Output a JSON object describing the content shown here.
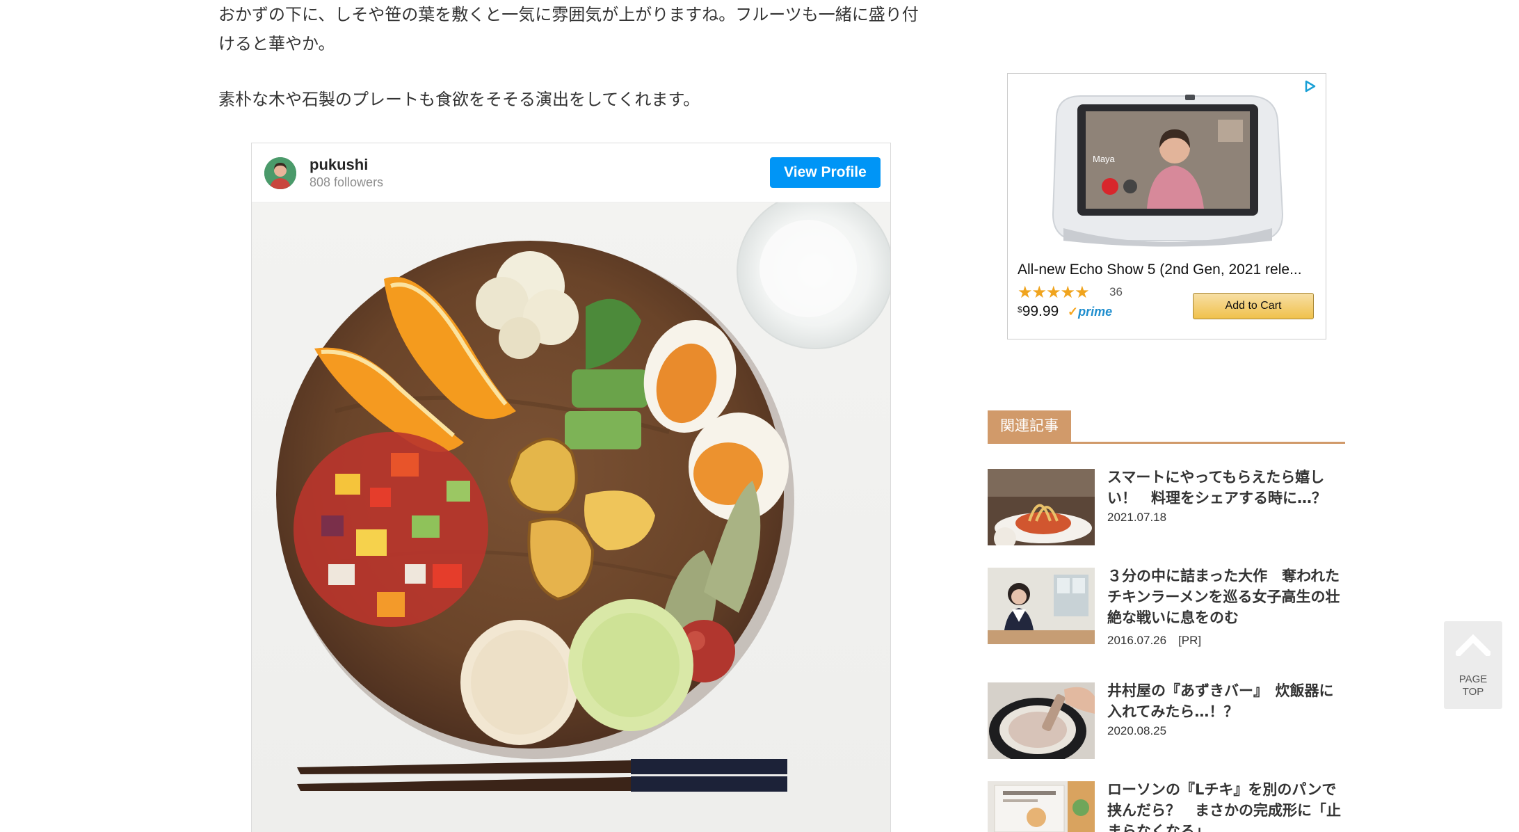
{
  "article": {
    "paragraph1": "おかずの下に、しそや笹の葉を敷くと一気に雰囲気が上がりますね。フルーツも一緒に盛り付けると華やか。",
    "paragraph2": "素朴な木や石製のプレートも食欲をそそる演出をしてくれます。"
  },
  "instagram": {
    "username": "pukushi",
    "followers": "808 followers",
    "view_profile_label": "View Profile",
    "button_color": "#0095f6"
  },
  "ad": {
    "title": "All-new Echo Show 5 (2nd Gen, 2021 rele...",
    "stars": "★★★★★",
    "rating": 4.5,
    "review_count": "36",
    "price_symbol": "$",
    "price": "99.99",
    "prime_label": "prime",
    "add_to_cart_label": "Add to Cart",
    "screen_caller": "Maya"
  },
  "related": {
    "header": "関連記事",
    "accent_color": "#d19a6a",
    "items": [
      {
        "title": "スマートにやってもらえたら嬉しい！　料理をシェアする時に…？",
        "date": "2021.07.18"
      },
      {
        "title": "３分の中に詰まった大作　奪われたチキンラーメンを巡る女子高生の壮絶な戦いに息をのむ",
        "date": "2016.07.26　[PR]"
      },
      {
        "title": "井村屋の『あずきバー』　炊飯器に入れてみたら…！？",
        "date": "2020.08.25"
      },
      {
        "title": "ローソンの『Lチキ』を別のパンで挟んだら？　まさかの完成形に「止まらなくなる」",
        "date": ""
      }
    ]
  },
  "page_top": {
    "line1": "PAGE",
    "line2": "TOP"
  }
}
